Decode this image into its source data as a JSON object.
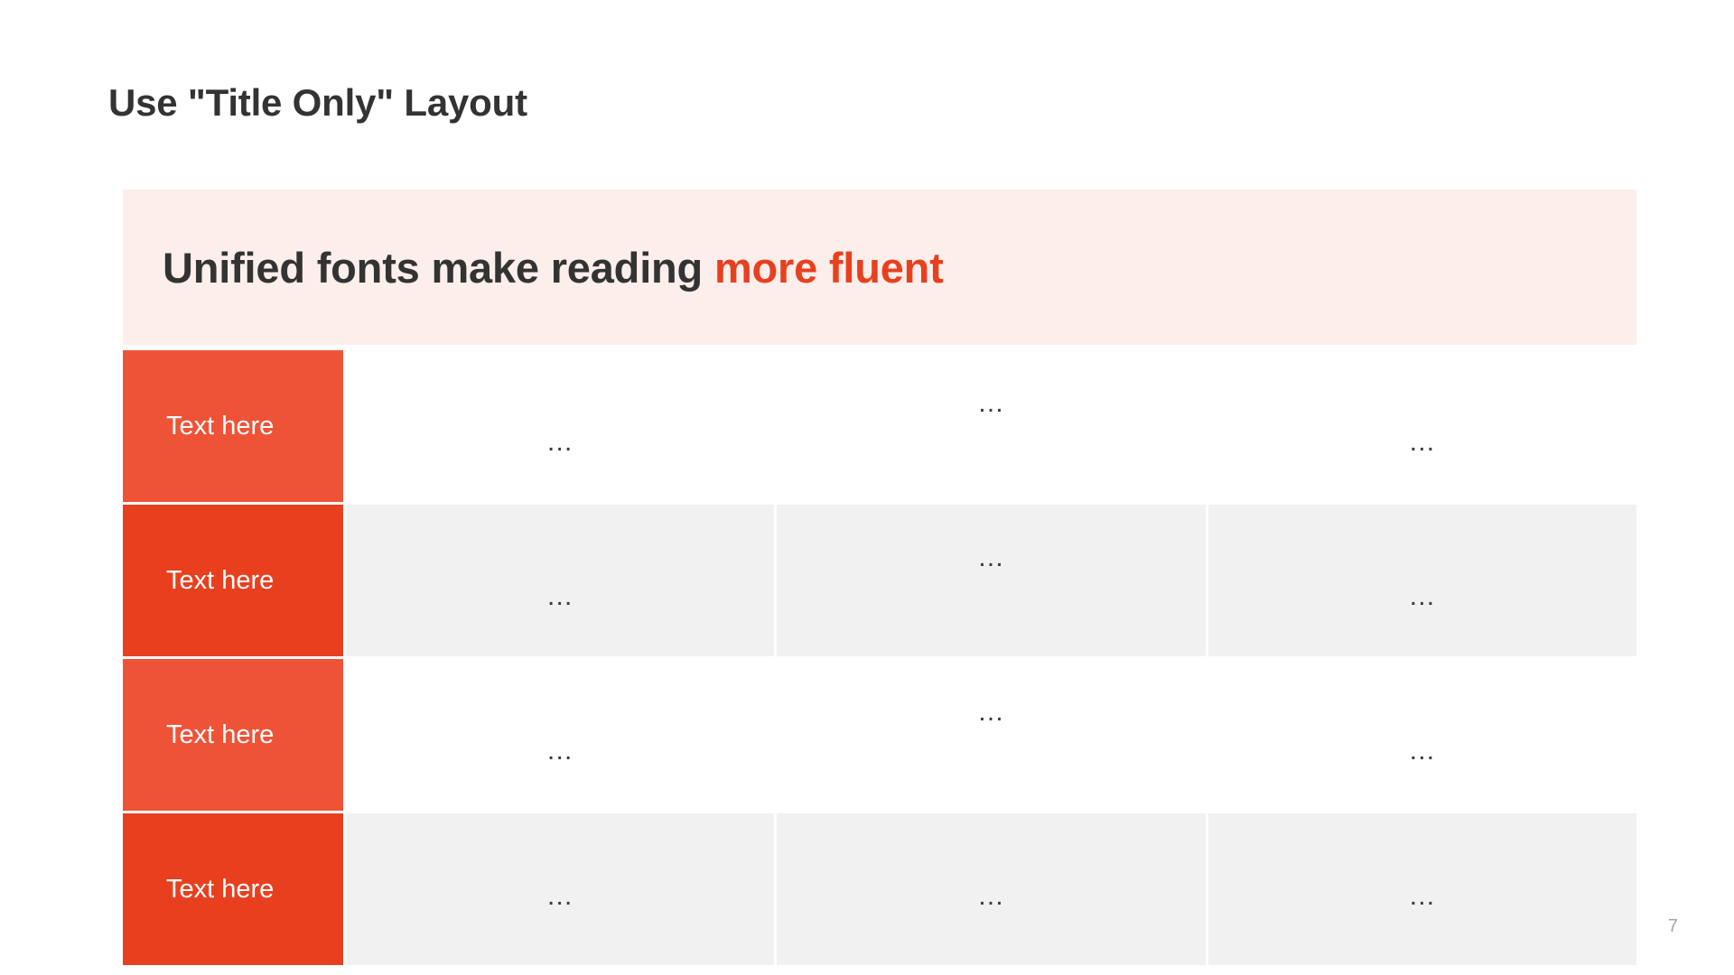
{
  "slide": {
    "title": "Use \"Title Only\" Layout",
    "page_number": "7",
    "colors": {
      "title_text": "#333333",
      "banner_background": "#FBEEEB",
      "accent_red": "#E8401F",
      "label_red_light": "#EF5337",
      "label_red_dark": "#E8401F",
      "cell_gray": "#F1F1F1",
      "page_number_text": "#A6A6A6"
    }
  },
  "banner": {
    "text_plain": "Unified fonts make reading ",
    "text_accent": "more fluent"
  },
  "table": {
    "rows": [
      {
        "label": "Text here",
        "cells": [
          "…",
          "…",
          "…"
        ]
      },
      {
        "label": "Text here",
        "cells": [
          "…",
          "…",
          "…"
        ]
      },
      {
        "label": "Text here",
        "cells": [
          "…",
          "…",
          "…"
        ]
      },
      {
        "label": "Text here",
        "cells": [
          "…",
          "…",
          "…"
        ]
      }
    ]
  }
}
